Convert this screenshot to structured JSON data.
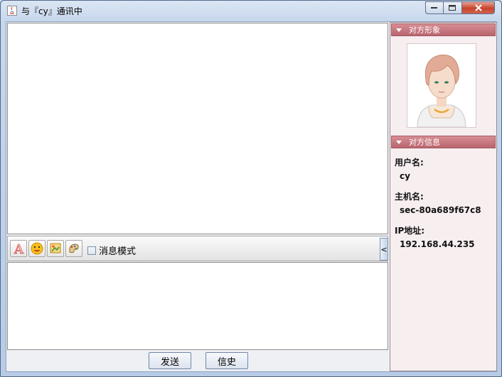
{
  "window": {
    "title": "与『cy』通讯中",
    "controls": [
      "minimize",
      "maximize",
      "close"
    ]
  },
  "toolbar": {
    "tools": [
      "font-icon",
      "emoji-icon",
      "image-icon",
      "screenshot-icon"
    ],
    "message_mode_label": "消息模式",
    "message_mode_checked": false,
    "collapse_label": "<"
  },
  "buttons": {
    "send": "发送",
    "history": "信史"
  },
  "right_panel": {
    "avatar_header": "对方形象",
    "info_header": "对方信息",
    "username_label": "用户名:",
    "username": "cy",
    "hostname_label": "主机名:",
    "hostname": "sec-80a689f67c8",
    "ip_label": "IP地址:",
    "ip": "192.168.44.235"
  },
  "colors": {
    "panel_header": "#c97a82",
    "panel_bg": "#f7eef0",
    "title_bar": "#c6d7ec"
  }
}
